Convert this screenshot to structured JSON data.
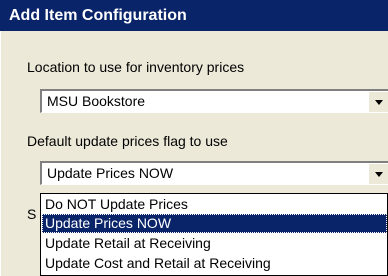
{
  "window": {
    "title": "Add Item Configuration"
  },
  "location": {
    "label": "Location to use for inventory prices",
    "value": "MSU  Bookstore"
  },
  "price_flag": {
    "label": "Default update prices flag to use",
    "value": "Update Prices NOW",
    "options": [
      "Do NOT Update Prices",
      "Update Prices NOW",
      "Update Retail at Receiving",
      "Update Cost and Retail at Receiving"
    ],
    "selected_index": 1
  },
  "hidden_label_fragment": "S",
  "colors": {
    "titlebar": "#0a246a",
    "dialog_bg": "#ece9d8",
    "selection": "#0a246a"
  },
  "icons": {
    "combo_arrow": "chevron-down-icon"
  }
}
